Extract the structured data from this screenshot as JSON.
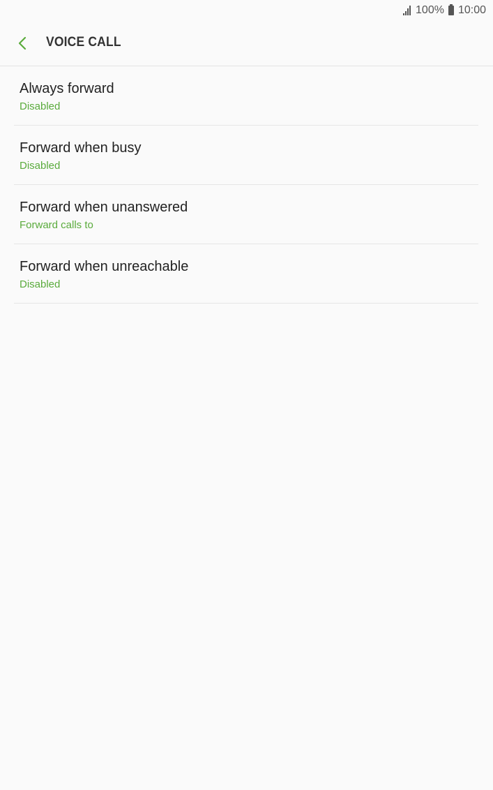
{
  "status_bar": {
    "battery_level": "100%",
    "time": "10:00"
  },
  "header": {
    "title": "VOICE CALL"
  },
  "colors": {
    "accent": "#5aab3c",
    "background": "#fafafa",
    "divider": "#e6e6e6"
  },
  "items": [
    {
      "title": "Always forward",
      "subtitle": "Disabled"
    },
    {
      "title": "Forward when busy",
      "subtitle": "Disabled"
    },
    {
      "title": "Forward when unanswered",
      "subtitle": "Forward calls to"
    },
    {
      "title": "Forward when unreachable",
      "subtitle": "Disabled"
    }
  ]
}
